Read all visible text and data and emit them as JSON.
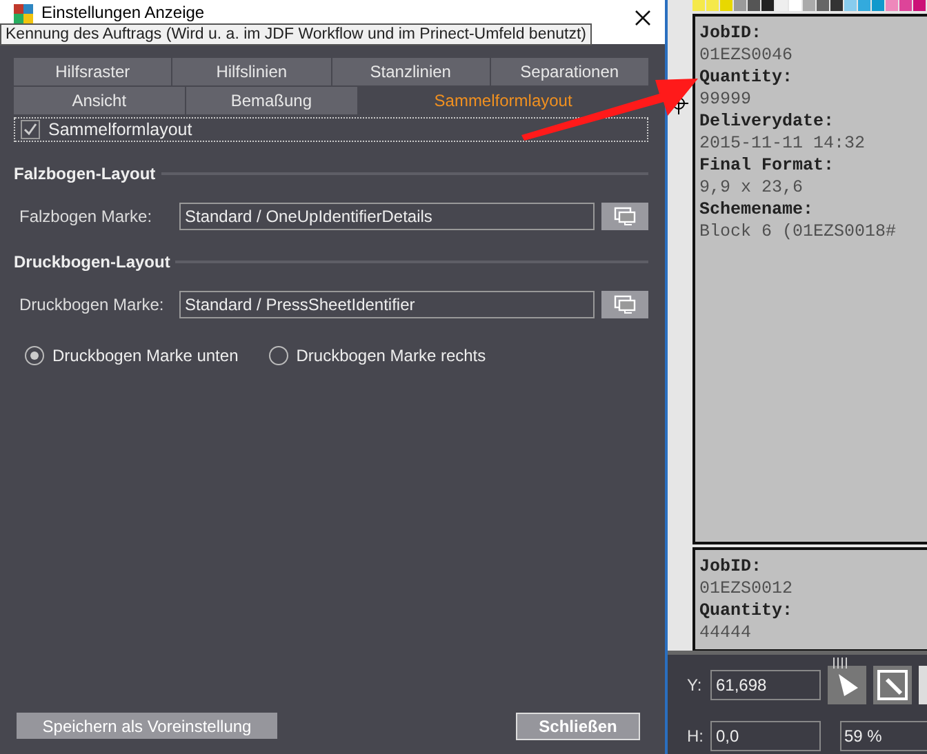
{
  "window": {
    "title": "Einstellungen Anzeige"
  },
  "tooltip": "Kennung des Auftrags (Wird u. a. im JDF Workflow und im Prinect-Umfeld benutzt)",
  "tab_rows": [
    [
      {
        "label": "Hilfsraster",
        "selected": false
      },
      {
        "label": "Hilfslinien",
        "selected": false
      },
      {
        "label": "Stanzlinien",
        "selected": false
      },
      {
        "label": "Separationen",
        "selected": false
      }
    ],
    [
      {
        "label": "Ansicht",
        "selected": false
      },
      {
        "label": "Bemaßung",
        "selected": false
      },
      {
        "label": "Sammelformlayout",
        "selected": true
      }
    ]
  ],
  "checkbox": {
    "label": "Sammelformlayout",
    "checked": true
  },
  "sections": [
    {
      "title": "Falzbogen-Layout",
      "field_label": "Falzbogen Marke:",
      "value": "Standard / OneUpIdentifierDetails"
    },
    {
      "title": "Druckbogen-Layout",
      "field_label": "Druckbogen Marke:",
      "value": "Standard / PressSheetIdentifier"
    }
  ],
  "radios": [
    {
      "label": "Druckbogen Marke unten",
      "selected": true
    },
    {
      "label": "Druckbogen Marke rechts",
      "selected": false
    }
  ],
  "buttons": {
    "save": "Speichern als Voreinstellung",
    "close": "Schließen"
  },
  "cards": [
    {
      "fields": [
        {
          "label": "JobID:",
          "value": "01EZS0046"
        },
        {
          "label": "Quantity:",
          "value": "99999"
        },
        {
          "label": "Deliverydate:",
          "value": "2015-11-11 14:32"
        },
        {
          "label": "Final Format:",
          "value": "9,9 x 23,6"
        },
        {
          "label": "Schemename:",
          "value": "Block 6 (01EZS0018#"
        }
      ]
    },
    {
      "fields": [
        {
          "label": "JobID:",
          "value": "01EZS0012"
        },
        {
          "label": "Quantity:",
          "value": "44444"
        }
      ]
    }
  ],
  "bottom_panel": {
    "y_label": "Y:",
    "y_value": "61,698",
    "h_label": "H:",
    "h_value": "0,0",
    "zoom": "59 %"
  }
}
